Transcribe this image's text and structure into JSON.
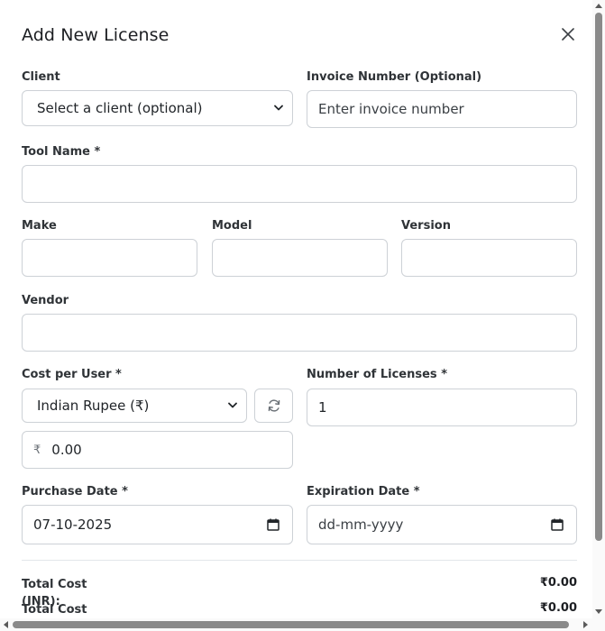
{
  "dialog": {
    "title": "Add New License"
  },
  "client": {
    "label": "Client",
    "selected": "Select a client (optional)"
  },
  "invoice": {
    "label": "Invoice Number (Optional)",
    "placeholder": "Enter invoice number"
  },
  "tool_name": {
    "label": "Tool Name *",
    "value": ""
  },
  "make": {
    "label": "Make",
    "value": ""
  },
  "model": {
    "label": "Model",
    "value": ""
  },
  "version": {
    "label": "Version",
    "value": ""
  },
  "vendor": {
    "label": "Vendor",
    "value": ""
  },
  "cost": {
    "label": "Cost per User *",
    "currency_selected": "Indian Rupee (₹)",
    "currency_symbol": "₹",
    "amount": "0.00"
  },
  "num_licenses": {
    "label": "Number of Licenses *",
    "value": "1"
  },
  "purchase_date": {
    "label": "Purchase Date *",
    "value": "07-10-2025"
  },
  "expiration_date": {
    "label": "Expiration Date *",
    "placeholder": "dd-mm-yyyy"
  },
  "totals": [
    {
      "label": "Total Cost (INR):",
      "value": "₹0.00"
    },
    {
      "label": "Total Cost",
      "value": "₹0.00"
    }
  ],
  "icons": {
    "close": "close-icon",
    "refresh": "refresh-icon",
    "calendar": "calendar-icon",
    "caret": "chevron-down-icon"
  }
}
